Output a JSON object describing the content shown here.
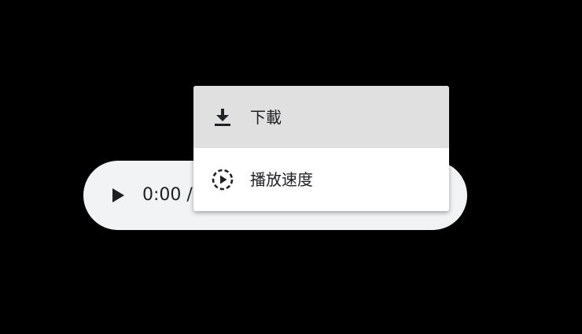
{
  "player": {
    "time_text": "0:00 /",
    "play_icon": "play-icon"
  },
  "menu": {
    "items": [
      {
        "label": "下載",
        "icon": "download-icon",
        "hovered": true
      },
      {
        "label": "播放速度",
        "icon": "playback-speed-icon",
        "hovered": false
      }
    ]
  },
  "colors": {
    "background": "#000000",
    "player_bg": "#f1f3f4",
    "menu_bg": "#ffffff",
    "menu_hover": "#e0e0e0",
    "text": "#202124"
  }
}
